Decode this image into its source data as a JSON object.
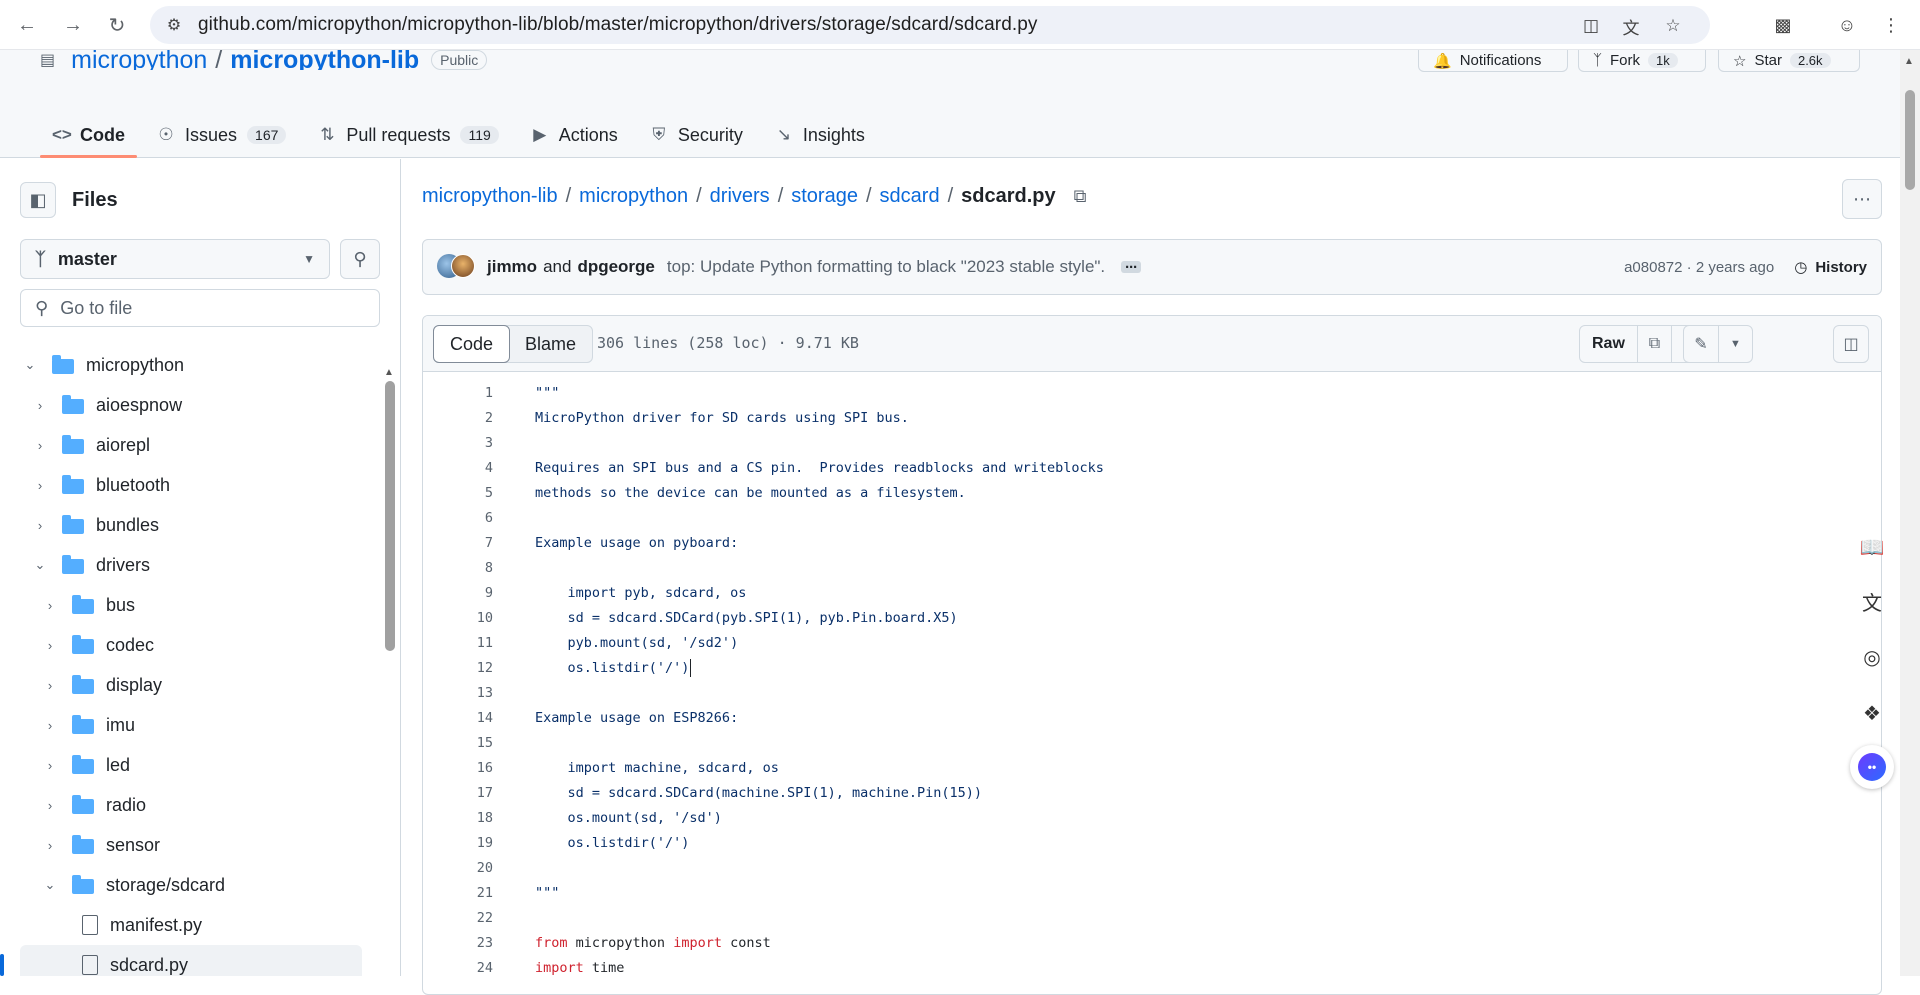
{
  "browser": {
    "url": "github.com/micropython/micropython-lib/blob/master/micropython/drivers/storage/sdcard/sdcard.py"
  },
  "repo": {
    "owner": "micropython",
    "name": "micropython-lib",
    "visibility": "Public",
    "notifications_label": "Notifications",
    "fork_label": "Fork",
    "fork_count": "1k",
    "star_label": "Star",
    "star_count": "2.6k"
  },
  "tabs": [
    {
      "label": "Code",
      "count": null
    },
    {
      "label": "Issues",
      "count": "167"
    },
    {
      "label": "Pull requests",
      "count": "119"
    },
    {
      "label": "Actions",
      "count": null
    },
    {
      "label": "Security",
      "count": null
    },
    {
      "label": "Insights",
      "count": null
    }
  ],
  "sidebar": {
    "title": "Files",
    "branch": "master",
    "goto_placeholder": "Go to file",
    "tree": [
      {
        "label": "micropython",
        "type": "folder",
        "expanded": true,
        "depth": 0
      },
      {
        "label": "aioespnow",
        "type": "folder",
        "expanded": false,
        "depth": 1
      },
      {
        "label": "aiorepl",
        "type": "folder",
        "expanded": false,
        "depth": 1
      },
      {
        "label": "bluetooth",
        "type": "folder",
        "expanded": false,
        "depth": 1
      },
      {
        "label": "bundles",
        "type": "folder",
        "expanded": false,
        "depth": 1
      },
      {
        "label": "drivers",
        "type": "folder",
        "expanded": true,
        "depth": 1
      },
      {
        "label": "bus",
        "type": "folder",
        "expanded": false,
        "depth": 2
      },
      {
        "label": "codec",
        "type": "folder",
        "expanded": false,
        "depth": 2
      },
      {
        "label": "display",
        "type": "folder",
        "expanded": false,
        "depth": 2
      },
      {
        "label": "imu",
        "type": "folder",
        "expanded": false,
        "depth": 2
      },
      {
        "label": "led",
        "type": "folder",
        "expanded": false,
        "depth": 2
      },
      {
        "label": "radio",
        "type": "folder",
        "expanded": false,
        "depth": 2
      },
      {
        "label": "sensor",
        "type": "folder",
        "expanded": false,
        "depth": 2
      },
      {
        "label": "storage/sdcard",
        "type": "folder",
        "expanded": true,
        "depth": 2
      },
      {
        "label": "manifest.py",
        "type": "file",
        "depth": 3
      },
      {
        "label": "sdcard.py",
        "type": "file",
        "depth": 3,
        "selected": true
      }
    ]
  },
  "breadcrumb": {
    "parts": [
      "micropython-lib",
      "micropython",
      "drivers",
      "storage",
      "sdcard"
    ],
    "current": "sdcard.py"
  },
  "commit": {
    "author1": "jimmo",
    "and": "and",
    "author2": "dpgeorge",
    "message": "top: Update Python formatting to black \"2023 stable style\".",
    "sha_time": "a080872 · 2 years ago",
    "history_label": "History"
  },
  "code_view": {
    "code_tab": "Code",
    "blame_tab": "Blame",
    "file_info": "306 lines (258 loc) · 9.71 KB",
    "raw_label": "Raw",
    "lines": [
      {
        "n": "1",
        "text": "\"\"\""
      },
      {
        "n": "2",
        "text": "MicroPython driver for SD cards using SPI bus."
      },
      {
        "n": "3",
        "text": ""
      },
      {
        "n": "4",
        "text": "Requires an SPI bus and a CS pin.  Provides readblocks and writeblocks"
      },
      {
        "n": "5",
        "text": "methods so the device can be mounted as a filesystem."
      },
      {
        "n": "6",
        "text": ""
      },
      {
        "n": "7",
        "text": "Example usage on pyboard:"
      },
      {
        "n": "8",
        "text": ""
      },
      {
        "n": "9",
        "text": "    import pyb, sdcard, os"
      },
      {
        "n": "10",
        "text": "    sd = sdcard.SDCard(pyb.SPI(1), pyb.Pin.board.X5)"
      },
      {
        "n": "11",
        "text": "    pyb.mount(sd, '/sd2')"
      },
      {
        "n": "12",
        "text": "    os.listdir('/')"
      },
      {
        "n": "13",
        "text": ""
      },
      {
        "n": "14",
        "text": "Example usage on ESP8266:"
      },
      {
        "n": "15",
        "text": ""
      },
      {
        "n": "16",
        "text": "    import machine, sdcard, os"
      },
      {
        "n": "17",
        "text": "    sd = sdcard.SDCard(machine.SPI(1), machine.Pin(15))"
      },
      {
        "n": "18",
        "text": "    os.mount(sd, '/sd')"
      },
      {
        "n": "19",
        "text": "    os.listdir('/')"
      },
      {
        "n": "20",
        "text": ""
      },
      {
        "n": "21",
        "text": "\"\"\""
      },
      {
        "n": "22",
        "text": ""
      }
    ],
    "line23": {
      "n": "23",
      "kw1": "from",
      "mod": " micropython ",
      "kw2": "import",
      "rest": " const"
    },
    "line24": {
      "n": "24",
      "kw1": "import",
      "rest": " time"
    }
  },
  "colors": {
    "link": "#0969da",
    "tab_underline": "#fd8c73",
    "folder": "#54aeff",
    "string": "#0a3069",
    "keyword": "#cf222e"
  }
}
